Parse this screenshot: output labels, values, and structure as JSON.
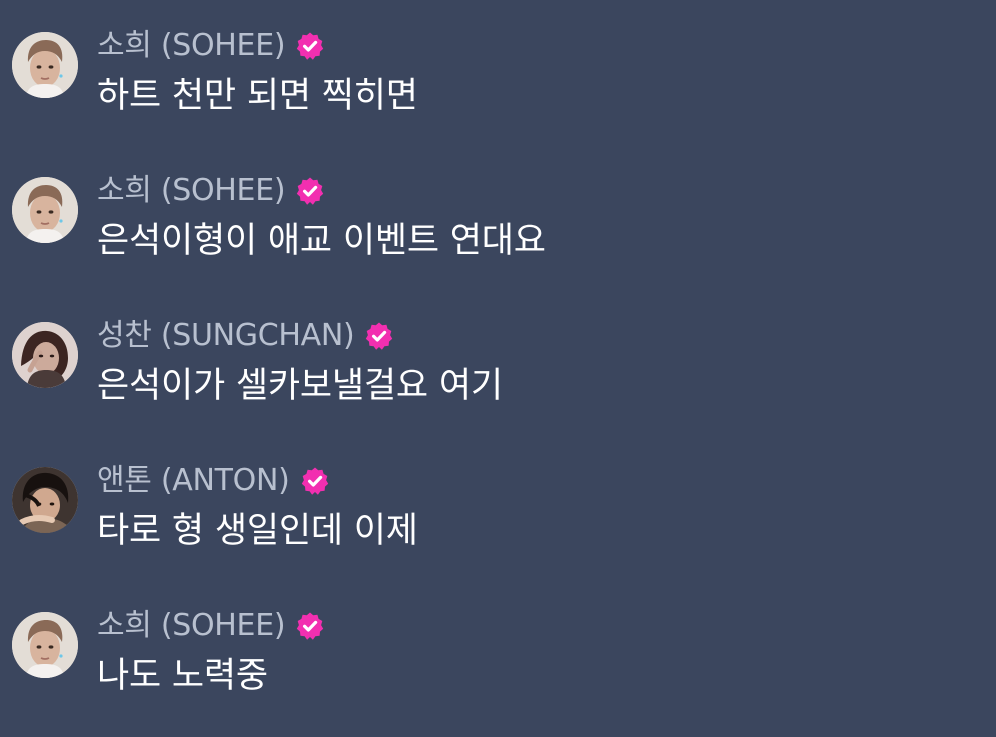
{
  "messages": [
    {
      "avatar_icon": "sohee-avatar",
      "sender": "소희 (SOHEE)",
      "verified_icon": "verified-badge-icon",
      "text": "하트 천만 되면 찍히면"
    },
    {
      "avatar_icon": "sohee-avatar",
      "sender": "소희 (SOHEE)",
      "verified_icon": "verified-badge-icon",
      "text": "은석이형이 애교 이벤트 연대요"
    },
    {
      "avatar_icon": "sungchan-avatar",
      "sender": "성찬 (SUNGCHAN)",
      "verified_icon": "verified-badge-icon",
      "text": "은석이가 셀카보낼걸요 여기"
    },
    {
      "avatar_icon": "anton-avatar",
      "sender": "앤톤 (ANTON)",
      "verified_icon": "verified-badge-icon",
      "text": "타로 형 생일인데 이제"
    },
    {
      "avatar_icon": "sohee-avatar",
      "sender": "소희 (SOHEE)",
      "verified_icon": "verified-badge-icon",
      "text": "나도 노력중"
    }
  ],
  "colors": {
    "background": "#3b465e",
    "sender_name": "#b8c0cf",
    "message_text": "#ffffff",
    "verified_badge": "#f22fb0"
  }
}
